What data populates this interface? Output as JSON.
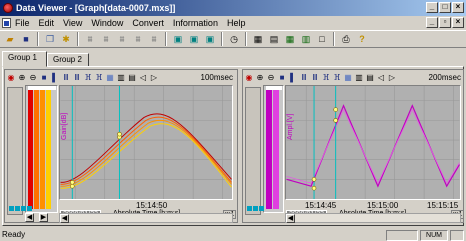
{
  "window": {
    "title": "Data Viewer - [Graph[data-0007.mxs]]"
  },
  "menu": [
    "File",
    "Edit",
    "View",
    "Window",
    "Convert",
    "Information",
    "Help"
  ],
  "tabs": [
    "Group 1",
    "Group 2"
  ],
  "panels": [
    {
      "rate": "100msec",
      "ylabel": "Gain[dB]",
      "xtick": "15:14:50",
      "xlabel": "Absolute Time [h:m:s]",
      "date": "2008/01/23",
      "zoom": "x:1",
      "bars": [
        "#e00000",
        "#ff7000",
        "#ff9000",
        "#ffd000"
      ]
    },
    {
      "rate": "200msec",
      "ylabel": "Ampl.[V]",
      "xticks": [
        "15:14:45",
        "15:15:00",
        "15:15:15"
      ],
      "xlabel": "Absolute Time [h:m:s]",
      "date": "2008/01/23",
      "zoom": "x:1",
      "bars": [
        "#c000c0",
        "#e040e0"
      ]
    }
  ],
  "status": {
    "text": "Ready",
    "num": "NUM"
  },
  "colors": {
    "title_start": "#0a246a",
    "title_end": "#a6caf0",
    "plot_bg": "#b0b0b0",
    "cursor": "#00c0c0"
  },
  "icons": [
    "open-icon",
    "save-icon",
    "copy-icon",
    "settings-icon",
    "waveform-icon",
    "cursor-icon",
    "timer-icon",
    "print-icon",
    "help-icon",
    "zoom-in-icon",
    "zoom-out-icon",
    "bar-graph-icon",
    "split-icon"
  ]
}
